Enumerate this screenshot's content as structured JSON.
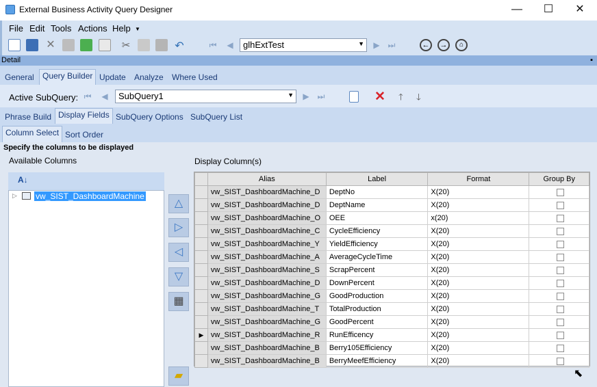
{
  "window": {
    "title": "External Business Activity Query Designer",
    "minimize": "—",
    "maximize": "☐",
    "close": "✕"
  },
  "menu": [
    "File",
    "Edit",
    "Tools",
    "Actions",
    "Help"
  ],
  "toolbar": {
    "query_name": "glhExtTest"
  },
  "detail_label": "Detail",
  "main_tabs": [
    "General",
    "Query Builder",
    "Update",
    "Analyze",
    "Where Used"
  ],
  "subquery": {
    "label": "Active SubQuery:",
    "value": "SubQuery1"
  },
  "sub_tabs": [
    "Phrase Build",
    "Display Fields",
    "SubQuery Options",
    "SubQuery List"
  ],
  "inner_tabs": [
    "Column Select",
    "Sort Order"
  ],
  "instruction": "Specify the columns to be displayed",
  "available": {
    "label": "Available Columns",
    "tree_item": "vw_SIST_DashboardMachine"
  },
  "display": {
    "label": "Display Column(s)",
    "headers": [
      "Alias",
      "Label",
      "Format",
      "Group By"
    ],
    "rows": [
      {
        "alias": "vw_SIST_DashboardMachine_D",
        "label": "DeptNo",
        "format": "X(20)"
      },
      {
        "alias": "vw_SIST_DashboardMachine_D",
        "label": "DeptName",
        "format": "X(20)"
      },
      {
        "alias": "vw_SIST_DashboardMachine_O",
        "label": "OEE",
        "format": "x(20)"
      },
      {
        "alias": "vw_SIST_DashboardMachine_C",
        "label": "CycleEfficiency",
        "format": "X(20)"
      },
      {
        "alias": "vw_SIST_DashboardMachine_Y",
        "label": "YieldEfficiency",
        "format": "X(20)"
      },
      {
        "alias": "vw_SIST_DashboardMachine_A",
        "label": "AverageCycleTime",
        "format": "X(20)"
      },
      {
        "alias": "vw_SIST_DashboardMachine_S",
        "label": "ScrapPercent",
        "format": "X(20)"
      },
      {
        "alias": "vw_SIST_DashboardMachine_D",
        "label": "DownPercent",
        "format": "X(20)"
      },
      {
        "alias": "vw_SIST_DashboardMachine_G",
        "label": "GoodProduction",
        "format": "X(20)"
      },
      {
        "alias": "vw_SIST_DashboardMachine_T",
        "label": "TotalProduction",
        "format": "X(20)"
      },
      {
        "alias": "vw_SIST_DashboardMachine_G",
        "label": "GoodPercent",
        "format": "X(20)"
      },
      {
        "alias": "vw_SIST_DashboardMachine_R",
        "label": "RunEfficency",
        "format": "X(20)",
        "current": true
      },
      {
        "alias": "vw_SIST_DashboardMachine_B",
        "label": "Berry105Efficiency",
        "format": "X(20)"
      },
      {
        "alias": "vw_SIST_DashboardMachine_B",
        "label": "BerryMeefEfficiency",
        "format": "X(20)"
      }
    ]
  }
}
